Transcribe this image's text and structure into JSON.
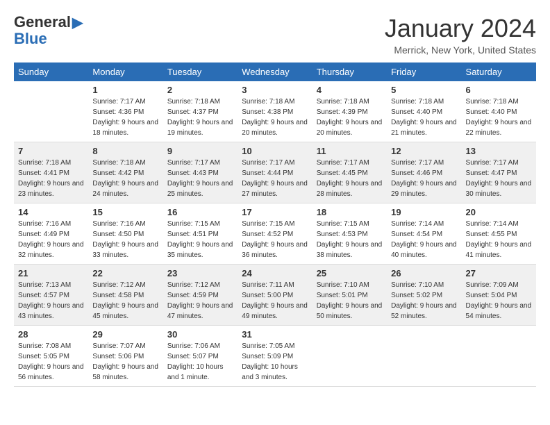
{
  "logo": {
    "general": "General",
    "blue": "Blue"
  },
  "title": "January 2024",
  "location": "Merrick, New York, United States",
  "days_header": [
    "Sunday",
    "Monday",
    "Tuesday",
    "Wednesday",
    "Thursday",
    "Friday",
    "Saturday"
  ],
  "weeks": [
    [
      {
        "num": "",
        "sunrise": "",
        "sunset": "",
        "daylight": ""
      },
      {
        "num": "1",
        "sunrise": "Sunrise: 7:17 AM",
        "sunset": "Sunset: 4:36 PM",
        "daylight": "Daylight: 9 hours and 18 minutes."
      },
      {
        "num": "2",
        "sunrise": "Sunrise: 7:18 AM",
        "sunset": "Sunset: 4:37 PM",
        "daylight": "Daylight: 9 hours and 19 minutes."
      },
      {
        "num": "3",
        "sunrise": "Sunrise: 7:18 AM",
        "sunset": "Sunset: 4:38 PM",
        "daylight": "Daylight: 9 hours and 20 minutes."
      },
      {
        "num": "4",
        "sunrise": "Sunrise: 7:18 AM",
        "sunset": "Sunset: 4:39 PM",
        "daylight": "Daylight: 9 hours and 20 minutes."
      },
      {
        "num": "5",
        "sunrise": "Sunrise: 7:18 AM",
        "sunset": "Sunset: 4:40 PM",
        "daylight": "Daylight: 9 hours and 21 minutes."
      },
      {
        "num": "6",
        "sunrise": "Sunrise: 7:18 AM",
        "sunset": "Sunset: 4:40 PM",
        "daylight": "Daylight: 9 hours and 22 minutes."
      }
    ],
    [
      {
        "num": "7",
        "sunrise": "Sunrise: 7:18 AM",
        "sunset": "Sunset: 4:41 PM",
        "daylight": "Daylight: 9 hours and 23 minutes."
      },
      {
        "num": "8",
        "sunrise": "Sunrise: 7:18 AM",
        "sunset": "Sunset: 4:42 PM",
        "daylight": "Daylight: 9 hours and 24 minutes."
      },
      {
        "num": "9",
        "sunrise": "Sunrise: 7:17 AM",
        "sunset": "Sunset: 4:43 PM",
        "daylight": "Daylight: 9 hours and 25 minutes."
      },
      {
        "num": "10",
        "sunrise": "Sunrise: 7:17 AM",
        "sunset": "Sunset: 4:44 PM",
        "daylight": "Daylight: 9 hours and 27 minutes."
      },
      {
        "num": "11",
        "sunrise": "Sunrise: 7:17 AM",
        "sunset": "Sunset: 4:45 PM",
        "daylight": "Daylight: 9 hours and 28 minutes."
      },
      {
        "num": "12",
        "sunrise": "Sunrise: 7:17 AM",
        "sunset": "Sunset: 4:46 PM",
        "daylight": "Daylight: 9 hours and 29 minutes."
      },
      {
        "num": "13",
        "sunrise": "Sunrise: 7:17 AM",
        "sunset": "Sunset: 4:47 PM",
        "daylight": "Daylight: 9 hours and 30 minutes."
      }
    ],
    [
      {
        "num": "14",
        "sunrise": "Sunrise: 7:16 AM",
        "sunset": "Sunset: 4:49 PM",
        "daylight": "Daylight: 9 hours and 32 minutes."
      },
      {
        "num": "15",
        "sunrise": "Sunrise: 7:16 AM",
        "sunset": "Sunset: 4:50 PM",
        "daylight": "Daylight: 9 hours and 33 minutes."
      },
      {
        "num": "16",
        "sunrise": "Sunrise: 7:15 AM",
        "sunset": "Sunset: 4:51 PM",
        "daylight": "Daylight: 9 hours and 35 minutes."
      },
      {
        "num": "17",
        "sunrise": "Sunrise: 7:15 AM",
        "sunset": "Sunset: 4:52 PM",
        "daylight": "Daylight: 9 hours and 36 minutes."
      },
      {
        "num": "18",
        "sunrise": "Sunrise: 7:15 AM",
        "sunset": "Sunset: 4:53 PM",
        "daylight": "Daylight: 9 hours and 38 minutes."
      },
      {
        "num": "19",
        "sunrise": "Sunrise: 7:14 AM",
        "sunset": "Sunset: 4:54 PM",
        "daylight": "Daylight: 9 hours and 40 minutes."
      },
      {
        "num": "20",
        "sunrise": "Sunrise: 7:14 AM",
        "sunset": "Sunset: 4:55 PM",
        "daylight": "Daylight: 9 hours and 41 minutes."
      }
    ],
    [
      {
        "num": "21",
        "sunrise": "Sunrise: 7:13 AM",
        "sunset": "Sunset: 4:57 PM",
        "daylight": "Daylight: 9 hours and 43 minutes."
      },
      {
        "num": "22",
        "sunrise": "Sunrise: 7:12 AM",
        "sunset": "Sunset: 4:58 PM",
        "daylight": "Daylight: 9 hours and 45 minutes."
      },
      {
        "num": "23",
        "sunrise": "Sunrise: 7:12 AM",
        "sunset": "Sunset: 4:59 PM",
        "daylight": "Daylight: 9 hours and 47 minutes."
      },
      {
        "num": "24",
        "sunrise": "Sunrise: 7:11 AM",
        "sunset": "Sunset: 5:00 PM",
        "daylight": "Daylight: 9 hours and 49 minutes."
      },
      {
        "num": "25",
        "sunrise": "Sunrise: 7:10 AM",
        "sunset": "Sunset: 5:01 PM",
        "daylight": "Daylight: 9 hours and 50 minutes."
      },
      {
        "num": "26",
        "sunrise": "Sunrise: 7:10 AM",
        "sunset": "Sunset: 5:02 PM",
        "daylight": "Daylight: 9 hours and 52 minutes."
      },
      {
        "num": "27",
        "sunrise": "Sunrise: 7:09 AM",
        "sunset": "Sunset: 5:04 PM",
        "daylight": "Daylight: 9 hours and 54 minutes."
      }
    ],
    [
      {
        "num": "28",
        "sunrise": "Sunrise: 7:08 AM",
        "sunset": "Sunset: 5:05 PM",
        "daylight": "Daylight: 9 hours and 56 minutes."
      },
      {
        "num": "29",
        "sunrise": "Sunrise: 7:07 AM",
        "sunset": "Sunset: 5:06 PM",
        "daylight": "Daylight: 9 hours and 58 minutes."
      },
      {
        "num": "30",
        "sunrise": "Sunrise: 7:06 AM",
        "sunset": "Sunset: 5:07 PM",
        "daylight": "Daylight: 10 hours and 1 minute."
      },
      {
        "num": "31",
        "sunrise": "Sunrise: 7:05 AM",
        "sunset": "Sunset: 5:09 PM",
        "daylight": "Daylight: 10 hours and 3 minutes."
      },
      {
        "num": "",
        "sunrise": "",
        "sunset": "",
        "daylight": ""
      },
      {
        "num": "",
        "sunrise": "",
        "sunset": "",
        "daylight": ""
      },
      {
        "num": "",
        "sunrise": "",
        "sunset": "",
        "daylight": ""
      }
    ]
  ]
}
